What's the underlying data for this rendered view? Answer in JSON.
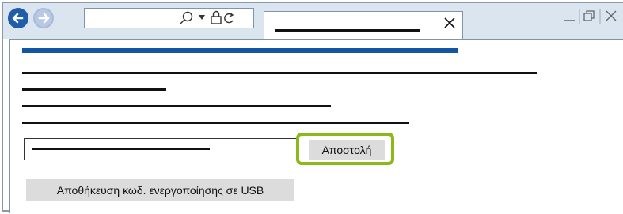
{
  "browser": {
    "back_icon": "arrow-left-icon",
    "forward_icon": "arrow-right-icon",
    "address_icons": [
      "search-icon",
      "dropdown-icon",
      "lock-icon",
      "refresh-icon"
    ],
    "tab_close_icon": "close-icon",
    "window_controls": [
      "minimize-icon",
      "restore-icon",
      "close-icon"
    ]
  },
  "form": {
    "send_button_label": "Αποστολή",
    "usb_button_label": "Αποθήκευση κωδ. ενεργοποίησης σε USB"
  },
  "colors": {
    "accent_bar": "#1155a5",
    "highlight": "#8cb81b",
    "titlebar": "#dbe5ef"
  }
}
